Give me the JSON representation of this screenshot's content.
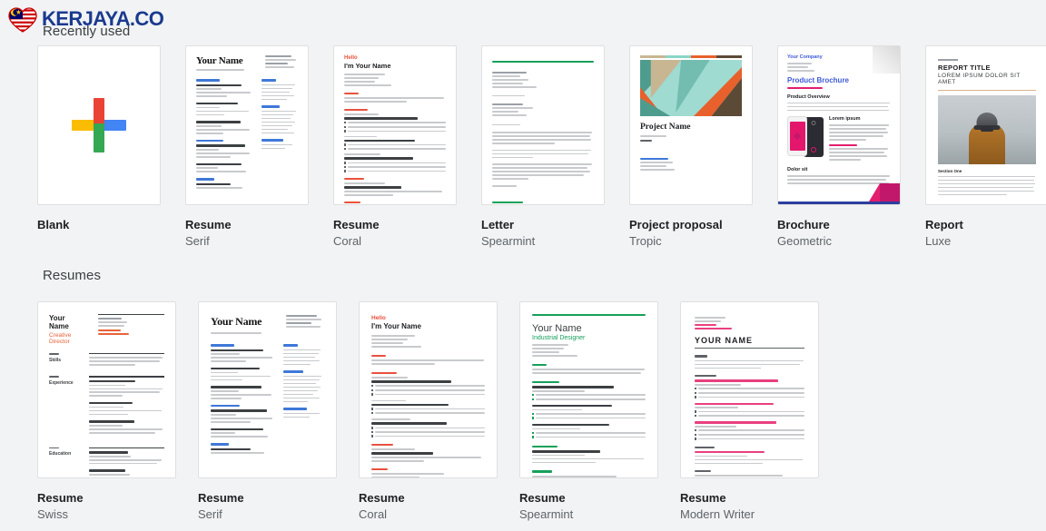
{
  "brand": {
    "name": "KERJAYA.CO",
    "color": "#1a3a8f",
    "logo_icon": "malaysia-flag-heart-icon"
  },
  "background_color": "#f1f3f4",
  "sections": [
    {
      "id": "recently-used",
      "heading": "Recently used",
      "cards": [
        {
          "title": "Blank",
          "subtitle": "",
          "thumb": "blank-plus"
        },
        {
          "title": "Resume",
          "subtitle": "Serif",
          "thumb": "resume-serif"
        },
        {
          "title": "Resume",
          "subtitle": "Coral",
          "thumb": "resume-coral"
        },
        {
          "title": "Letter",
          "subtitle": "Spearmint",
          "thumb": "letter-spearmint"
        },
        {
          "title": "Project proposal",
          "subtitle": "Tropic",
          "thumb": "project-tropic"
        },
        {
          "title": "Brochure",
          "subtitle": "Geometric",
          "thumb": "brochure-geometric"
        },
        {
          "title": "Report",
          "subtitle": "Luxe",
          "thumb": "report-luxe"
        }
      ]
    },
    {
      "id": "resumes",
      "heading": "Resumes",
      "cards": [
        {
          "title": "Resume",
          "subtitle": "Swiss",
          "thumb": "resume-swiss"
        },
        {
          "title": "Resume",
          "subtitle": "Serif",
          "thumb": "resume-serif2"
        },
        {
          "title": "Resume",
          "subtitle": "Coral",
          "thumb": "resume-coral2"
        },
        {
          "title": "Resume",
          "subtitle": "Spearmint",
          "thumb": "resume-spearmint"
        },
        {
          "title": "Resume",
          "subtitle": "Modern Writer",
          "thumb": "resume-modern-writer"
        }
      ]
    }
  ],
  "thumb_text": {
    "your_name": "Your Name",
    "project_name": "Project Name",
    "your_company": "Your Company",
    "product_brochure": "Product Brochure",
    "report_title": "REPORT TITLE",
    "report_subtitle": "LOREM IPSUM DOLOR SIT AMET",
    "hello": "Hello",
    "creative_director": "Creative Director",
    "industrial_designer": "Industrial Designer",
    "your_name_caps": "YOUR NAME"
  },
  "accent_colors": {
    "serif_blue": "#3f78d8",
    "coral": "#e8523f",
    "spearmint_green": "#16a05a",
    "modern_pink": "#e8407f",
    "swiss_orange": "#e8623a",
    "brochure_pink": "#e31e6e",
    "brochure_blue": "#2d3f9e",
    "luxe_tan": "#d8b48c"
  }
}
